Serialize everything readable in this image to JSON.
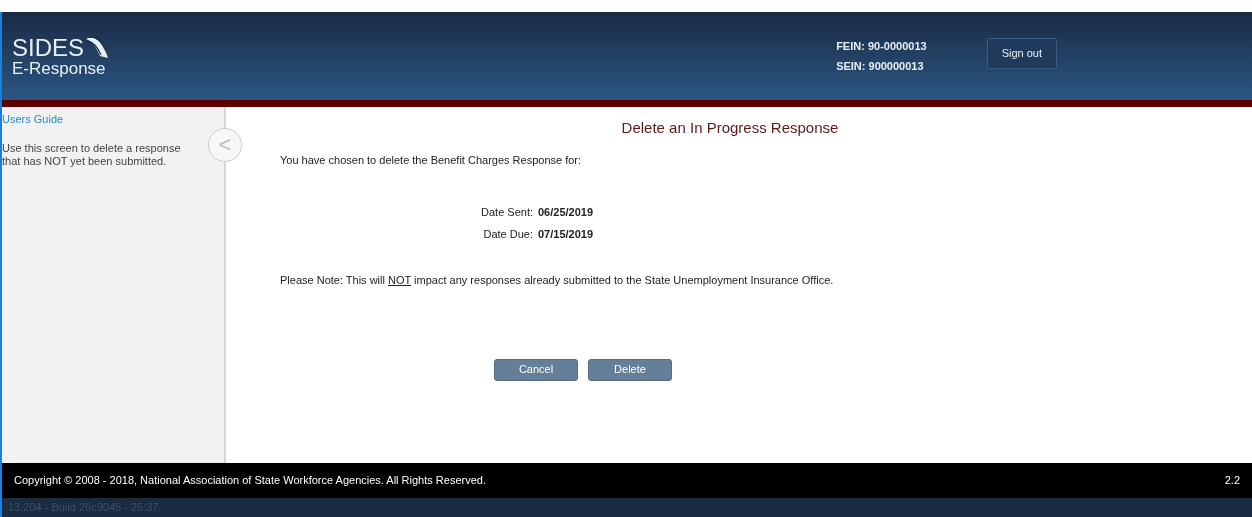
{
  "header": {
    "logo_title": "SIDES",
    "logo_subtitle": "E-Response",
    "fein": "FEIN: 90-0000013",
    "sein": "SEIN: 900000013",
    "sign_out": "Sign out"
  },
  "sidebar": {
    "link": "Users Guide",
    "help": "Use this screen to delete a response that has NOT yet been submitted.",
    "collapse_symbol": "<"
  },
  "main": {
    "title": "Delete an In Progress Response",
    "intro": "You have chosen to delete the Benefit Charges Response for:",
    "fields": [
      {
        "label": "Date Sent:",
        "value": "06/25/2019"
      },
      {
        "label": "Date Due:",
        "value": "07/15/2019"
      }
    ],
    "note": [
      {
        "text": "Please Note: This will ",
        "underline": false
      },
      {
        "text": "NOT",
        "underline": true
      },
      {
        "text": " impact any responses already submitted to the State Unemployment Insurance Office.",
        "underline": false
      }
    ],
    "buttons": [
      "Cancel",
      "Delete"
    ]
  },
  "footer": {
    "copyright": "Copyright © 2008 - 2018, National Association of State Workforce Agencies. All Rights Reserved.",
    "version": "2.2",
    "build": "13.204 - Build 26c9045 - 25:37"
  }
}
